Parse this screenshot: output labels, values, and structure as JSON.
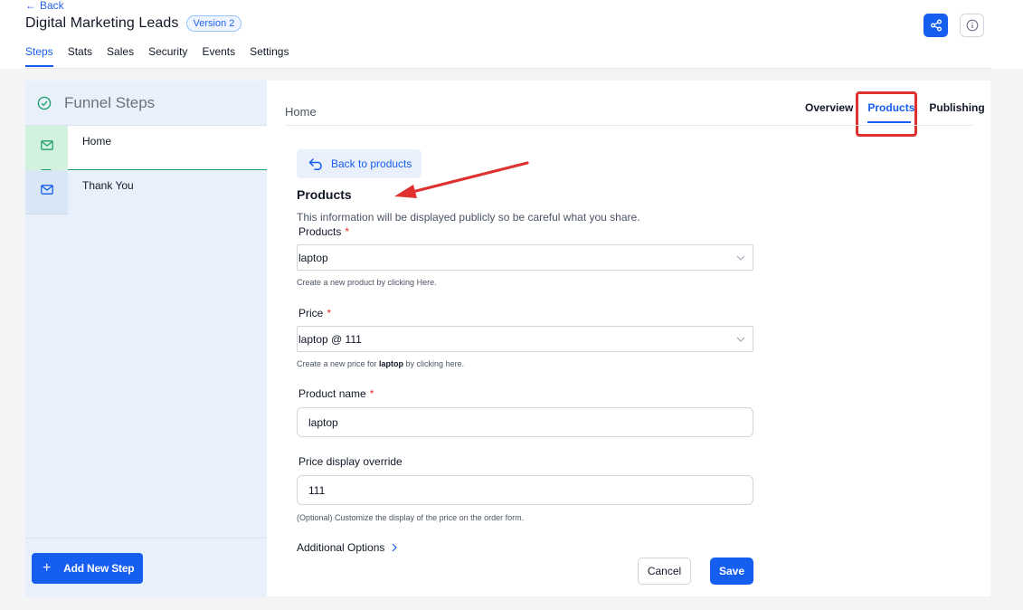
{
  "header": {
    "back_label": "Back",
    "title": "Digital Marketing Leads",
    "version_badge": "Version 2",
    "share_icon": "share-icon",
    "info_icon": "info-icon"
  },
  "top_tabs": [
    {
      "label": "Steps",
      "active": true
    },
    {
      "label": "Stats",
      "active": false
    },
    {
      "label": "Sales",
      "active": false
    },
    {
      "label": "Security",
      "active": false
    },
    {
      "label": "Events",
      "active": false
    },
    {
      "label": "Settings",
      "active": false
    }
  ],
  "sidebar": {
    "title": "Funnel Steps",
    "steps": [
      {
        "label": "Home",
        "icon": "mail-icon",
        "active": true
      },
      {
        "label": "Thank You",
        "icon": "mail-icon",
        "active": false
      }
    ],
    "add_step_label": "Add New Step"
  },
  "main": {
    "breadcrumb": "Home",
    "sub_tabs": [
      "Overview",
      "Products",
      "Publishing"
    ],
    "active_sub_tab": "Products",
    "back_to_products": "Back to products",
    "section_title": "Products",
    "section_description": "This information will be displayed publicly so be careful what you share.",
    "products_field": {
      "label": "Products",
      "value": "laptop",
      "help": "Create a new product by clicking Here."
    },
    "price_field": {
      "label": "Price",
      "value": "laptop @ 111",
      "help_prefix": "Create a new price for ",
      "help_bold": "laptop",
      "help_suffix": " by clicking here."
    },
    "product_name_field": {
      "label": "Product name",
      "value": "laptop"
    },
    "price_override_field": {
      "label": "Price display override",
      "value": "111",
      "help": "(Optional) Customize the display of the price on the order form."
    },
    "additional_options": "Additional Options",
    "cancel_label": "Cancel",
    "save_label": "Save"
  },
  "colors": {
    "accent": "#155eef",
    "annotation": "#e03131",
    "active_step": "#22a06b"
  }
}
